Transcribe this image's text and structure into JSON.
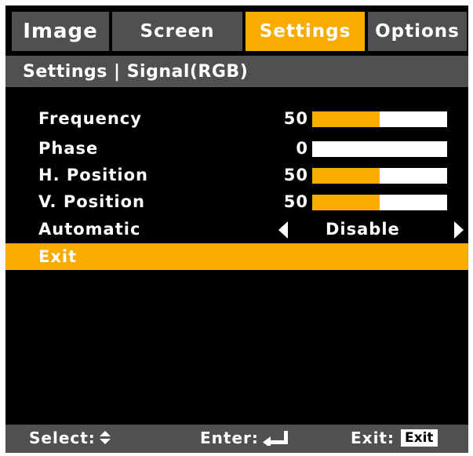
{
  "tabs": [
    {
      "label": "Image",
      "active": false
    },
    {
      "label": "Screen",
      "active": false
    },
    {
      "label": "Settings",
      "active": true
    },
    {
      "label": "Options",
      "active": false
    }
  ],
  "breadcrumb": "Settings | Signal(RGB)",
  "items": [
    {
      "label": "Frequency",
      "value": "50",
      "level": 0.5
    },
    {
      "label": "Phase",
      "value": "0",
      "level": 0.0
    },
    {
      "label": "H. Position",
      "value": "50",
      "level": 0.5
    },
    {
      "label": "V. Position",
      "value": "50",
      "level": 0.5
    }
  ],
  "automatic": {
    "label": "Automatic",
    "value": "Disable"
  },
  "exit": {
    "label": "Exit"
  },
  "footer": {
    "select_label": "Select:",
    "enter_label": "Enter:",
    "exit_label": "Exit:",
    "exit_key": "Exit"
  },
  "colors": {
    "accent": "#f9ab00",
    "panel": "#505050",
    "background": "#000000"
  },
  "icons": {
    "select": "up-down-arrows-icon",
    "enter": "enter-return-icon"
  }
}
